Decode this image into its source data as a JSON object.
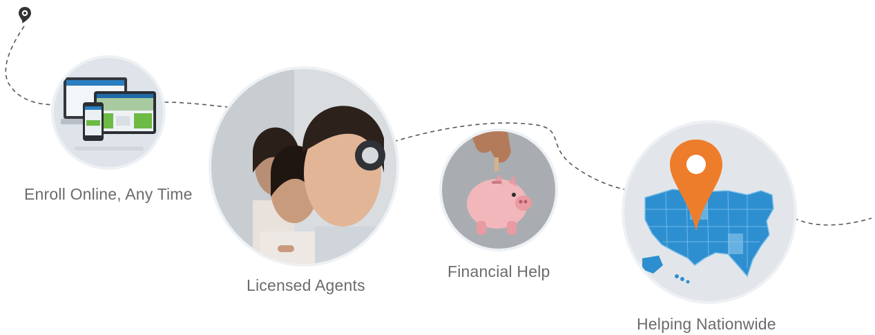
{
  "features": [
    {
      "id": "enroll",
      "label": "Enroll Online, Any Time",
      "icon": "devices-icon"
    },
    {
      "id": "agents",
      "label": "Licensed Agents",
      "icon": "call-center-agents-icon"
    },
    {
      "id": "financial",
      "label": "Financial Help",
      "icon": "piggy-bank-icon"
    },
    {
      "id": "nationwide",
      "label": "Helping Nationwide",
      "icon": "us-map-pin-icon"
    }
  ],
  "colors": {
    "caption": "#6b6b6b",
    "path": "#555555",
    "pin_orange": "#ee7d2b",
    "map_blue": "#2e8fd0",
    "screen_green": "#6dbb45"
  }
}
